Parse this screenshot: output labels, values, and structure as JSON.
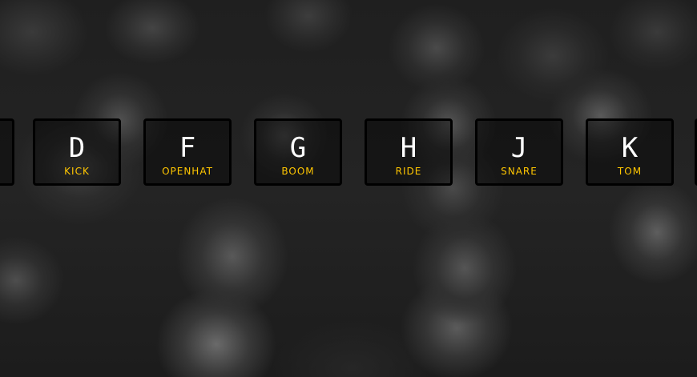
{
  "background": {
    "color": "#222222"
  },
  "accent_color": "#ffc600",
  "keys": [
    {
      "letter": "",
      "sound": ""
    },
    {
      "letter": "D",
      "sound": "KICK"
    },
    {
      "letter": "F",
      "sound": "OPENHAT"
    },
    {
      "letter": "G",
      "sound": "BOOM"
    },
    {
      "letter": "H",
      "sound": "RIDE"
    },
    {
      "letter": "J",
      "sound": "SNARE"
    },
    {
      "letter": "K",
      "sound": "TOM"
    },
    {
      "letter": "",
      "sound": ""
    }
  ]
}
